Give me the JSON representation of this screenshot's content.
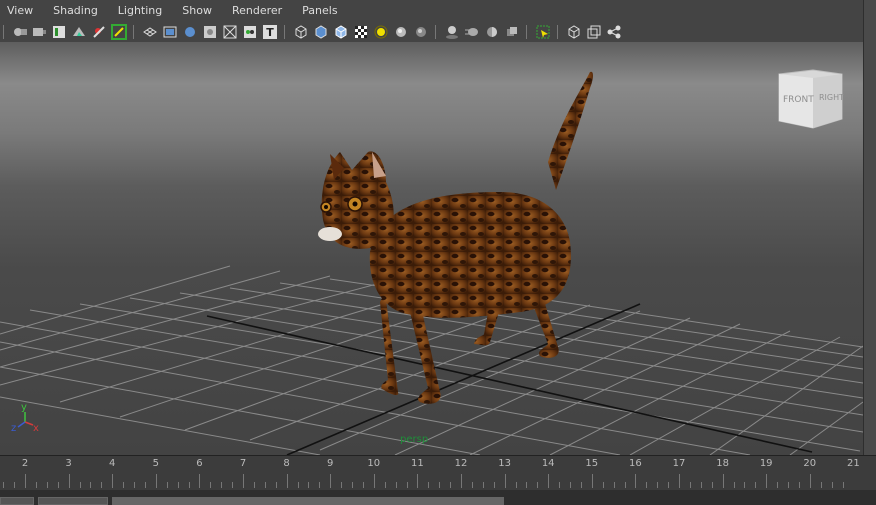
{
  "menubar": {
    "items": [
      "View",
      "Shading",
      "Lighting",
      "Show",
      "Renderer",
      "Panels"
    ]
  },
  "viewcube": {
    "front": "FRONT",
    "right": "RIGHT"
  },
  "axes": {
    "y": "y",
    "z": "z",
    "x": "x"
  },
  "camera": {
    "name": "persp"
  },
  "timeline": {
    "frames": [
      "2",
      "3",
      "4",
      "5",
      "6",
      "7",
      "8",
      "9",
      "10",
      "11",
      "12",
      "13",
      "14",
      "15",
      "16",
      "17",
      "18",
      "19",
      "20",
      "21"
    ]
  },
  "colors": {
    "axis_x": "#d33b3b",
    "axis_y": "#3ec43e",
    "axis_z": "#3a5bd0",
    "camera_label": "#1f8f3a",
    "highlight": "#f0e000"
  },
  "toolbar": {
    "text_icon": "T"
  }
}
